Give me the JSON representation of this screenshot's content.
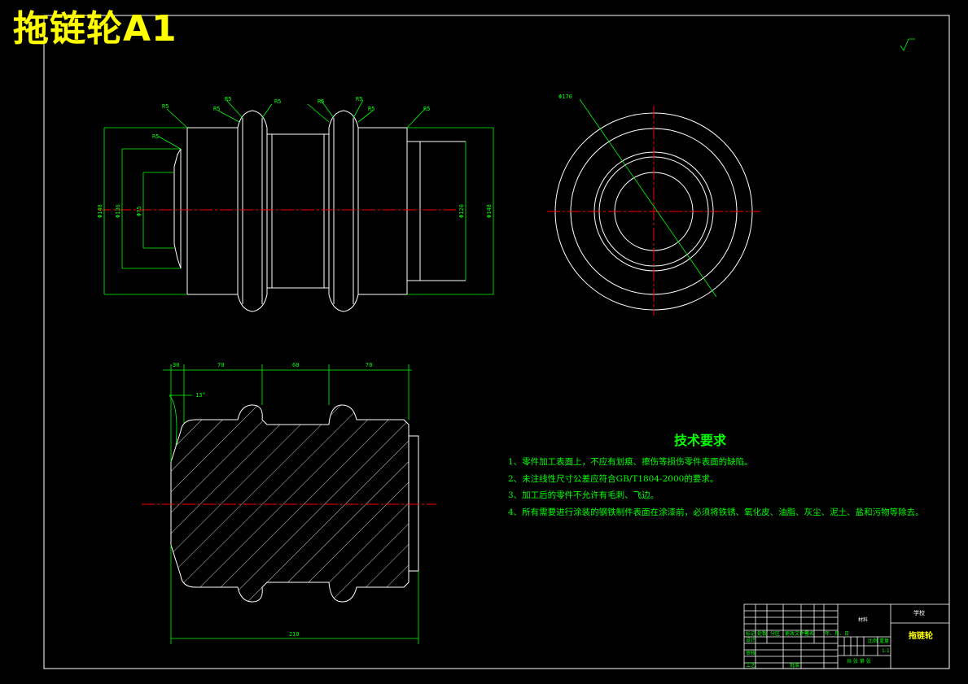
{
  "drawing_title": "拖链轮A1",
  "technical_requirements": {
    "heading": "技术要求",
    "items": [
      "1、零件加工表面上，不应有划痕、擦伤等损伤零件表面的缺陷。",
      "2、未注线性尺寸公差应符合GB/T1804-2000的要求。",
      "3、加工后的零件不允许有毛刺、飞边。",
      "4、所有需要进行涂装的钢铁制件表面在涂漆前，必须将铁锈、氧化皮、油脂、灰尘、泥土、盐和污物等除去。"
    ]
  },
  "dimensions": {
    "top_view": [
      "R5",
      "R5",
      "R5",
      "R5",
      "R5",
      "R5",
      "R5",
      "R5",
      "R5",
      "Φ148",
      "Φ136",
      "Φ75",
      "Φ120",
      "Φ148"
    ],
    "section_view": [
      "30",
      "70",
      "60",
      "70",
      "210",
      "13°"
    ],
    "side_view": [
      "Φ170"
    ]
  },
  "title_block": {
    "part_name": "拖链轮",
    "school": "学校",
    "material": "材料",
    "scale": "1:1",
    "scale_label": "比例",
    "weight_label": "重量",
    "sheet_label": "共 张 第 张",
    "row_labels": [
      "标记",
      "处数",
      "分区",
      "更改文件号",
      "签名",
      "年、月、日"
    ],
    "role_labels": [
      "设计",
      "审核",
      "工艺",
      "批准"
    ]
  },
  "colors": {
    "background": "#000000",
    "outline": "#ffffff",
    "dimension": "#00ff00",
    "centerline": "#ff0000",
    "title": "#ffff00"
  }
}
